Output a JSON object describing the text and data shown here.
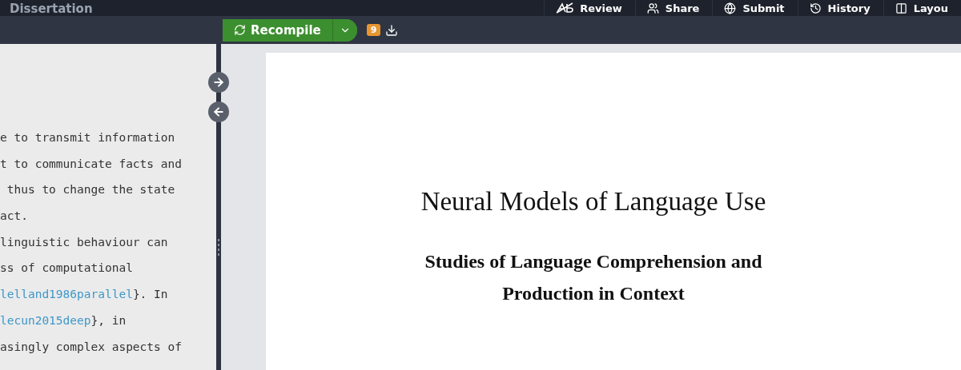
{
  "header": {
    "title": "Dissertation",
    "menu": [
      {
        "kind": "review",
        "label": "Review"
      },
      {
        "kind": "share",
        "label": "Share"
      },
      {
        "kind": "submit",
        "label": "Submit"
      },
      {
        "kind": "history",
        "label": "History"
      },
      {
        "kind": "layout",
        "label": "Layou"
      }
    ]
  },
  "toolbar": {
    "recompile": "Recompile",
    "log_count": "9"
  },
  "editor": {
    "lines": [
      [
        {
          "kind": "text",
          "text": "e to transmit information"
        }
      ],
      [
        {
          "kind": "text",
          "text": "t to communicate facts and"
        }
      ],
      [
        {
          "kind": "text",
          "text": " thus to change the state"
        }
      ],
      [
        {
          "kind": "text",
          "text": "act."
        }
      ],
      [
        {
          "kind": "text",
          "text": "linguistic behaviour can"
        }
      ],
      [
        {
          "kind": "text",
          "text": "ss of computational"
        }
      ],
      [
        {
          "kind": "citation",
          "text": "lelland1986parallel"
        },
        {
          "kind": "text",
          "text": "}. In"
        }
      ],
      [
        {
          "kind": "citation",
          "text": "lecun2015deep"
        },
        {
          "kind": "text",
          "text": "}, in"
        }
      ],
      [
        {
          "kind": "text",
          "text": "asingly complex aspects of"
        }
      ]
    ]
  },
  "pdf": {
    "title": "Neural Models of Language Use",
    "subtitle_lines": [
      "Studies of Language Comprehension and",
      "Production in Context"
    ]
  }
}
